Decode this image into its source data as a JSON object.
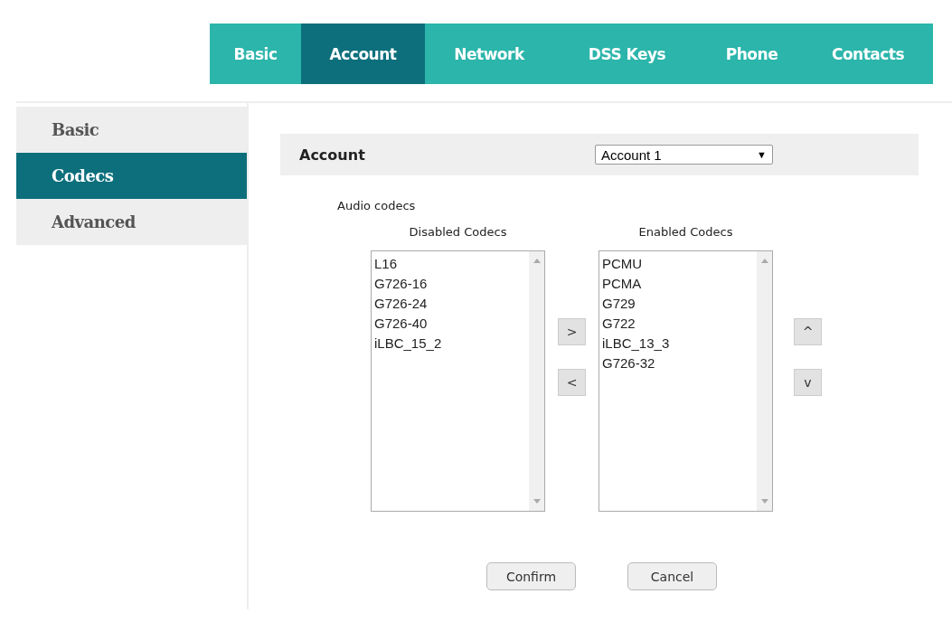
{
  "top_tabs": [
    {
      "label": "Basic",
      "selected": false
    },
    {
      "label": "Account",
      "selected": true
    },
    {
      "label": "Network",
      "selected": false
    },
    {
      "label": "DSS Keys",
      "selected": false
    },
    {
      "label": "Phone",
      "selected": false
    },
    {
      "label": "Contacts",
      "selected": false
    }
  ],
  "sidebar": {
    "items": [
      {
        "label": "Basic",
        "selected": false
      },
      {
        "label": "Codecs",
        "selected": true
      },
      {
        "label": "Advanced",
        "selected": false
      }
    ]
  },
  "account": {
    "label": "Account",
    "value": "Account 1",
    "arrow": "▼"
  },
  "section_title": "Audio codecs",
  "disabled_codecs": {
    "title": "Disabled Codecs",
    "items": [
      "L16",
      "G726-16",
      "G726-24",
      "G726-40",
      "iLBC_15_2"
    ]
  },
  "enabled_codecs": {
    "title": "Enabled Codecs",
    "items": [
      "PCMU",
      "PCMA",
      "G729",
      "G722",
      "iLBC_13_3",
      "G726-32"
    ]
  },
  "move_buttons": [
    ">",
    "<"
  ],
  "order_buttons": [
    "^",
    "v"
  ],
  "buttons": [
    "Confirm",
    "Cancel"
  ]
}
